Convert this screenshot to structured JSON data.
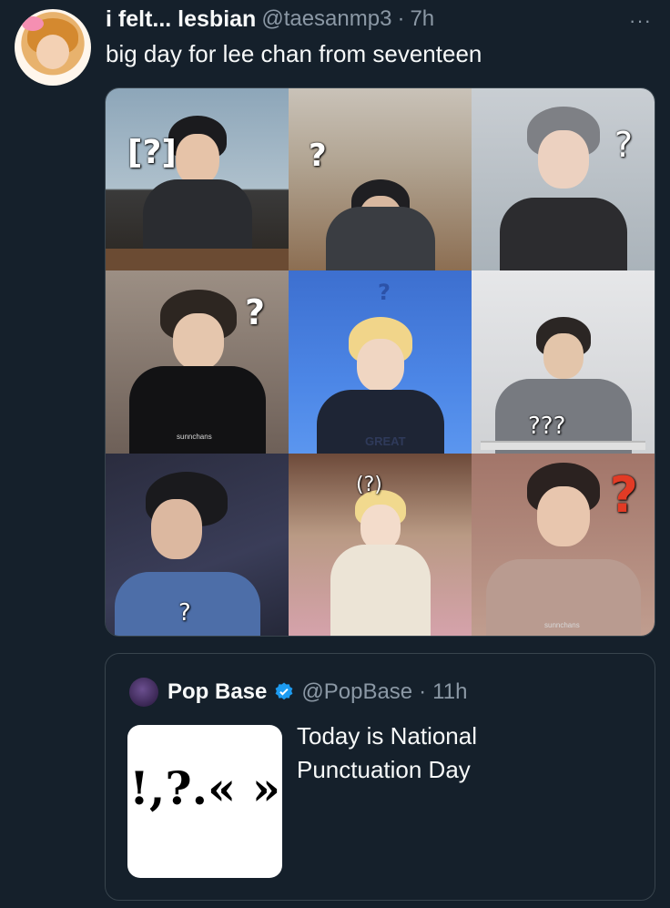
{
  "post": {
    "display_name": "i felt... lesbian",
    "handle": "@taesanmp3",
    "separator": "·",
    "time": "7h",
    "more_icon": "more-horizontal-icon",
    "more_glyph": "···",
    "text": "big day for lee chan from seventeen"
  },
  "media": {
    "tiles": [
      {
        "overlay": "[?]",
        "watermark": ""
      },
      {
        "overlay": "?",
        "watermark": ""
      },
      {
        "overlay": "?",
        "watermark": ""
      },
      {
        "overlay": "?",
        "watermark": "sunnchans"
      },
      {
        "overlay": "?",
        "watermark": ""
      },
      {
        "overlay": "???",
        "watermark": ""
      },
      {
        "overlay": "?",
        "watermark": ""
      },
      {
        "overlay": "(?)",
        "watermark": ""
      },
      {
        "overlay": "?",
        "watermark": "sunnchans"
      }
    ],
    "shirt_text": "GREAT"
  },
  "quote": {
    "display_name": "Pop Base",
    "verified_icon": "verified-badge-icon",
    "handle": "@PopBase",
    "separator": "·",
    "time": "11h",
    "thumbnail_text": "!,?.« »",
    "text": "Today is National Punctuation Day"
  },
  "colors": {
    "background": "#15202b",
    "text_primary": "#f7f9f9",
    "text_secondary": "#8b98a5",
    "border": "#38444d",
    "verified": "#1d9bf0"
  }
}
